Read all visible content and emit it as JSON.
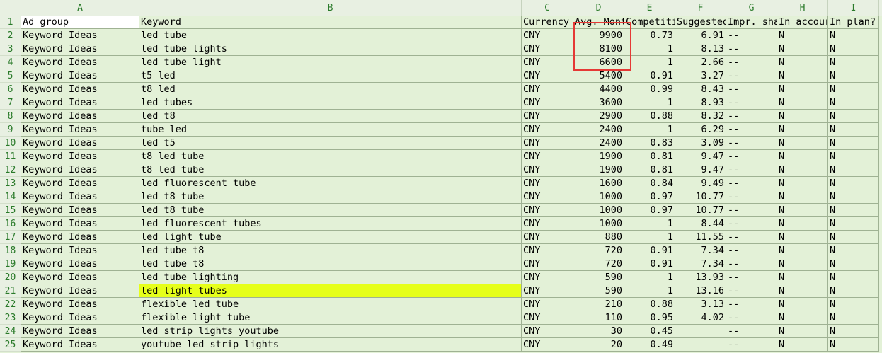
{
  "columns": [
    "A",
    "B",
    "C",
    "D",
    "E",
    "F",
    "G",
    "H",
    "I"
  ],
  "header_row": {
    "num": "1",
    "cells": [
      "Ad group",
      "Keyword",
      "Currency",
      "Avg. Mont",
      "Competiti",
      "Suggested",
      "Impr. sha",
      "In accour",
      "In plan?"
    ]
  },
  "rows": [
    {
      "num": "2",
      "ad_group": "Keyword Ideas",
      "keyword": "led tube",
      "currency": "CNY",
      "avg": "9900",
      "comp": "0.73",
      "bid": "6.91",
      "impr": "--",
      "acct": "N",
      "plan": "N"
    },
    {
      "num": "3",
      "ad_group": "Keyword Ideas",
      "keyword": "led tube lights",
      "currency": "CNY",
      "avg": "8100",
      "comp": "1",
      "bid": "8.13",
      "impr": "--",
      "acct": "N",
      "plan": "N"
    },
    {
      "num": "4",
      "ad_group": "Keyword Ideas",
      "keyword": "led tube light",
      "currency": "CNY",
      "avg": "6600",
      "comp": "1",
      "bid": "2.66",
      "impr": "--",
      "acct": "N",
      "plan": "N"
    },
    {
      "num": "5",
      "ad_group": "Keyword Ideas",
      "keyword": "t5 led",
      "currency": "CNY",
      "avg": "5400",
      "comp": "0.91",
      "bid": "3.27",
      "impr": "--",
      "acct": "N",
      "plan": "N"
    },
    {
      "num": "6",
      "ad_group": "Keyword Ideas",
      "keyword": "t8 led",
      "currency": "CNY",
      "avg": "4400",
      "comp": "0.99",
      "bid": "8.43",
      "impr": "--",
      "acct": "N",
      "plan": "N"
    },
    {
      "num": "7",
      "ad_group": "Keyword Ideas",
      "keyword": "led tubes",
      "currency": "CNY",
      "avg": "3600",
      "comp": "1",
      "bid": "8.93",
      "impr": "--",
      "acct": "N",
      "plan": "N"
    },
    {
      "num": "8",
      "ad_group": "Keyword Ideas",
      "keyword": "led t8",
      "currency": "CNY",
      "avg": "2900",
      "comp": "0.88",
      "bid": "8.32",
      "impr": "--",
      "acct": "N",
      "plan": "N"
    },
    {
      "num": "9",
      "ad_group": "Keyword Ideas",
      "keyword": "tube led",
      "currency": "CNY",
      "avg": "2400",
      "comp": "1",
      "bid": "6.29",
      "impr": "--",
      "acct": "N",
      "plan": "N"
    },
    {
      "num": "10",
      "ad_group": "Keyword Ideas",
      "keyword": "led t5",
      "currency": "CNY",
      "avg": "2400",
      "comp": "0.83",
      "bid": "3.09",
      "impr": "--",
      "acct": "N",
      "plan": "N"
    },
    {
      "num": "11",
      "ad_group": "Keyword Ideas",
      "keyword": "t8 led tube",
      "currency": "CNY",
      "avg": "1900",
      "comp": "0.81",
      "bid": "9.47",
      "impr": "--",
      "acct": "N",
      "plan": "N"
    },
    {
      "num": "12",
      "ad_group": "Keyword Ideas",
      "keyword": "t8 led tube",
      "currency": "CNY",
      "avg": "1900",
      "comp": "0.81",
      "bid": "9.47",
      "impr": "--",
      "acct": "N",
      "plan": "N"
    },
    {
      "num": "13",
      "ad_group": "Keyword Ideas",
      "keyword": "led fluorescent tube",
      "currency": "CNY",
      "avg": "1600",
      "comp": "0.84",
      "bid": "9.49",
      "impr": "--",
      "acct": "N",
      "plan": "N"
    },
    {
      "num": "14",
      "ad_group": "Keyword Ideas",
      "keyword": "led t8 tube",
      "currency": "CNY",
      "avg": "1000",
      "comp": "0.97",
      "bid": "10.77",
      "impr": "--",
      "acct": "N",
      "plan": "N"
    },
    {
      "num": "15",
      "ad_group": "Keyword Ideas",
      "keyword": "led t8 tube",
      "currency": "CNY",
      "avg": "1000",
      "comp": "0.97",
      "bid": "10.77",
      "impr": "--",
      "acct": "N",
      "plan": "N"
    },
    {
      "num": "16",
      "ad_group": "Keyword Ideas",
      "keyword": "led fluorescent tubes",
      "currency": "CNY",
      "avg": "1000",
      "comp": "1",
      "bid": "8.44",
      "impr": "--",
      "acct": "N",
      "plan": "N"
    },
    {
      "num": "17",
      "ad_group": "Keyword Ideas",
      "keyword": "led light tube",
      "currency": "CNY",
      "avg": "880",
      "comp": "1",
      "bid": "11.55",
      "impr": "--",
      "acct": "N",
      "plan": "N"
    },
    {
      "num": "18",
      "ad_group": "Keyword Ideas",
      "keyword": "led tube t8",
      "currency": "CNY",
      "avg": "720",
      "comp": "0.91",
      "bid": "7.34",
      "impr": "--",
      "acct": "N",
      "plan": "N"
    },
    {
      "num": "19",
      "ad_group": "Keyword Ideas",
      "keyword": "led tube t8",
      "currency": "CNY",
      "avg": "720",
      "comp": "0.91",
      "bid": "7.34",
      "impr": "--",
      "acct": "N",
      "plan": "N"
    },
    {
      "num": "20",
      "ad_group": "Keyword Ideas",
      "keyword": "led tube lighting",
      "currency": "CNY",
      "avg": "590",
      "comp": "1",
      "bid": "13.93",
      "impr": "--",
      "acct": "N",
      "plan": "N"
    },
    {
      "num": "21",
      "ad_group": "Keyword Ideas",
      "keyword": "led light tubes",
      "currency": "CNY",
      "avg": "590",
      "comp": "1",
      "bid": "13.16",
      "impr": "--",
      "acct": "N",
      "plan": "N",
      "highlight": "#e6ff1a"
    },
    {
      "num": "22",
      "ad_group": "Keyword Ideas",
      "keyword": "flexible led tube",
      "currency": "CNY",
      "avg": "210",
      "comp": "0.88",
      "bid": "3.13",
      "impr": "--",
      "acct": "N",
      "plan": "N"
    },
    {
      "num": "23",
      "ad_group": "Keyword Ideas",
      "keyword": "flexible light tube",
      "currency": "CNY",
      "avg": "110",
      "comp": "0.95",
      "bid": "4.02",
      "impr": "--",
      "acct": "N",
      "plan": "N"
    },
    {
      "num": "24",
      "ad_group": "Keyword Ideas",
      "keyword": "led strip lights youtube",
      "currency": "CNY",
      "avg": "30",
      "comp": "0.45",
      "bid": "",
      "impr": "--",
      "acct": "N",
      "plan": "N"
    },
    {
      "num": "25",
      "ad_group": "Keyword Ideas",
      "keyword": "youtube led strip lights",
      "currency": "CNY",
      "avg": "20",
      "comp": "0.49",
      "bid": "",
      "impr": "--",
      "acct": "N",
      "plan": "N"
    }
  ],
  "colors": {
    "grid_bg": "#e3f1d7",
    "highlight": "#e6ff1a",
    "box": "#e53935",
    "header_text": "#2a7a2a"
  }
}
